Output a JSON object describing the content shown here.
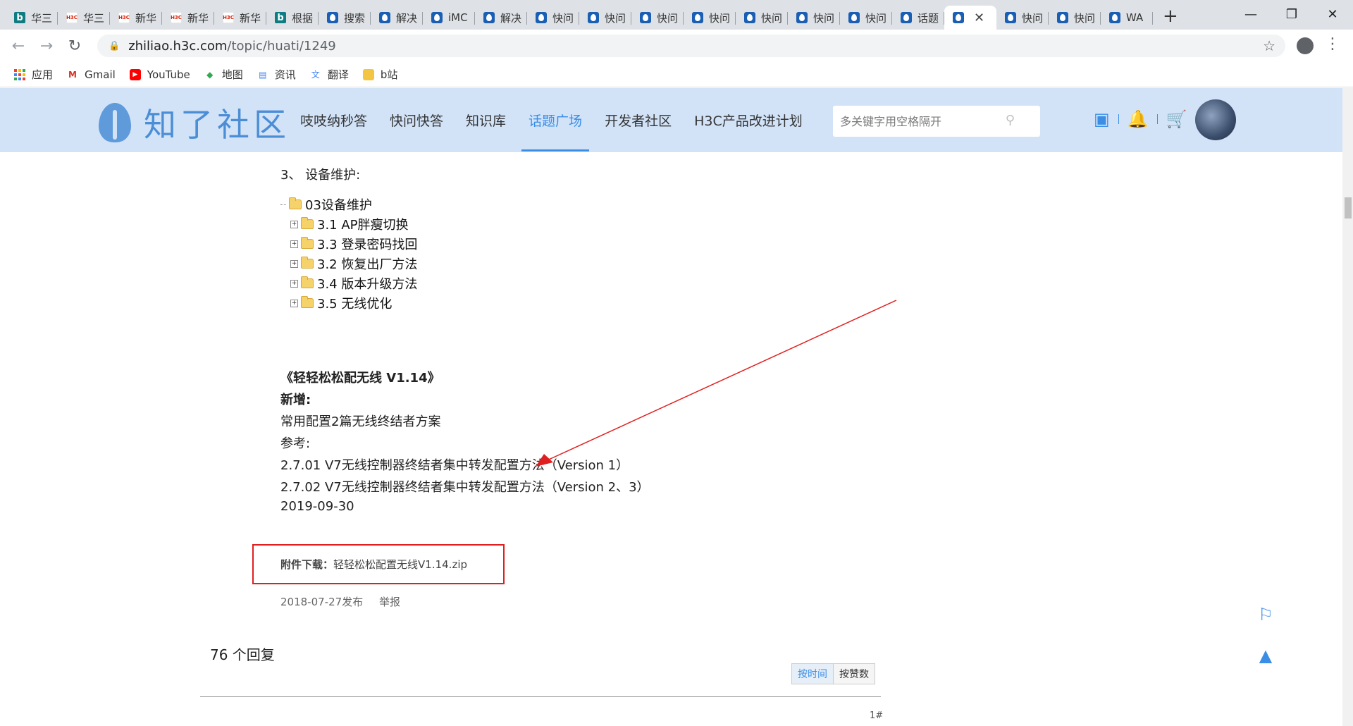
{
  "browser": {
    "tabs": [
      {
        "icon": "bing",
        "label": "华三"
      },
      {
        "icon": "h3c",
        "label": "华三"
      },
      {
        "icon": "h3c",
        "label": "新华"
      },
      {
        "icon": "h3c",
        "label": "新华"
      },
      {
        "icon": "h3c",
        "label": "新华"
      },
      {
        "icon": "bing",
        "label": "根据"
      },
      {
        "icon": "drop",
        "label": "搜索"
      },
      {
        "icon": "drop",
        "label": "解决"
      },
      {
        "icon": "drop",
        "label": "iMC"
      },
      {
        "icon": "drop",
        "label": "解决"
      },
      {
        "icon": "drop",
        "label": "快问"
      },
      {
        "icon": "drop",
        "label": "快问"
      },
      {
        "icon": "drop",
        "label": "快问"
      },
      {
        "icon": "drop",
        "label": "快问"
      },
      {
        "icon": "drop",
        "label": "快问"
      },
      {
        "icon": "drop",
        "label": "快问"
      },
      {
        "icon": "drop",
        "label": "快问"
      },
      {
        "icon": "drop",
        "label": "话题"
      },
      {
        "icon": "drop",
        "label": "",
        "active": true
      },
      {
        "icon": "drop",
        "label": "快问"
      },
      {
        "icon": "drop",
        "label": "快问"
      },
      {
        "icon": "drop",
        "label": "WA"
      }
    ],
    "new_tab": "+",
    "url_host": "zhiliao.h3c.com",
    "url_path": "/topic/huati/1249",
    "bookmarks": [
      {
        "label": "应用",
        "icon": "apps-grid-icon"
      },
      {
        "label": "Gmail",
        "icon": "gmail-icon",
        "color": "#d93025"
      },
      {
        "label": "YouTube",
        "icon": "youtube-icon",
        "color": "#ff0000"
      },
      {
        "label": "地图",
        "icon": "maps-icon",
        "color": "#34a853"
      },
      {
        "label": "资讯",
        "icon": "news-icon",
        "color": "#4285f4"
      },
      {
        "label": "翻译",
        "icon": "translate-icon",
        "color": "#4285f4"
      },
      {
        "label": "b站",
        "icon": "folder-icon",
        "color": "#f4c542"
      }
    ]
  },
  "site": {
    "logo_text": "知了社区",
    "nav": [
      "吱吱纳秒答",
      "快问快答",
      "知识库",
      "话题广场",
      "开发者社区",
      "H3C产品改进计划"
    ],
    "active_nav": "话题广场",
    "search_placeholder": "多关键字用空格隔开",
    "accent": "#3a8ee6"
  },
  "article": {
    "section_heading": "3、 设备维护:",
    "tree_root": "03设备维护",
    "tree_children": [
      "3.1 AP胖瘦切换",
      "3.3 登录密码找回",
      "3.2 恢复出厂方法",
      "3.4 版本升级方法",
      "3.5 无线优化"
    ],
    "release_title": "《轻轻松松配无线 V1.14》",
    "new_label": "新增:",
    "new_item": "常用配置2篇无线终结者方案",
    "ref_label": "参考:",
    "ref_items": [
      "2.7.01  V7无线控制器终结者集中转发配置方法（Version 1）",
      "2.7.02  V7无线控制器终结者集中转发配置方法（Version 2、3）"
    ],
    "date": "2019-09-30",
    "attach_label": "附件下载：",
    "attach_file": "轻轻松松配置无线V1.14.zip",
    "published": "2018-07-27发布",
    "report": "举报"
  },
  "replies": {
    "count_text": "76  个回复",
    "sort_time": "按时间",
    "sort_likes": "按赞数",
    "floor": "1#"
  }
}
